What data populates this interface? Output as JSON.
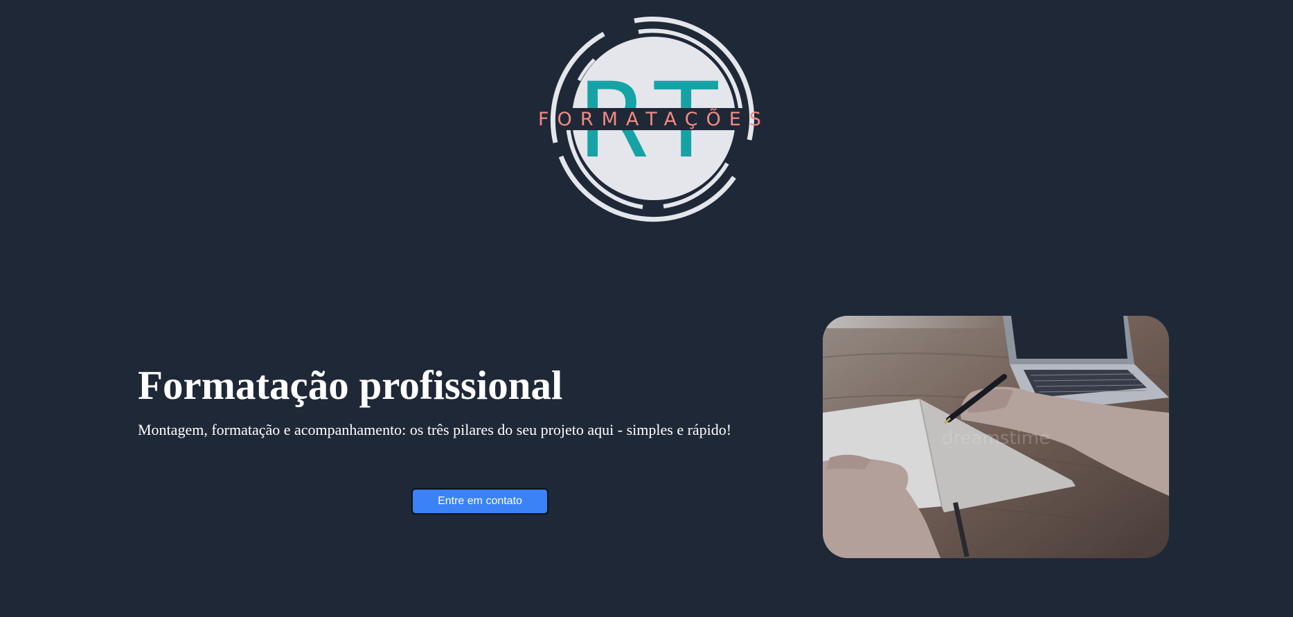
{
  "logo": {
    "monogram": "RT",
    "wordmark": "FORMATAÇÕES",
    "colors": {
      "circle": "#e4e6eb",
      "monogram": "#15a3a6",
      "wordmark": "#f28b82",
      "band": "#1f2837"
    }
  },
  "hero": {
    "title": "Formatação profissional",
    "subtitle": "Montagem, formatação e acompanhamento: os três pilares do seu projeto aqui - simples e rápido!",
    "cta_label": "Entre em contato",
    "image_alt": "hands-writing-in-notebook-photo",
    "watermark": "dreamstime"
  },
  "colors": {
    "background": "#1f2837",
    "button": "#3b82f6",
    "text": "#ffffff"
  }
}
